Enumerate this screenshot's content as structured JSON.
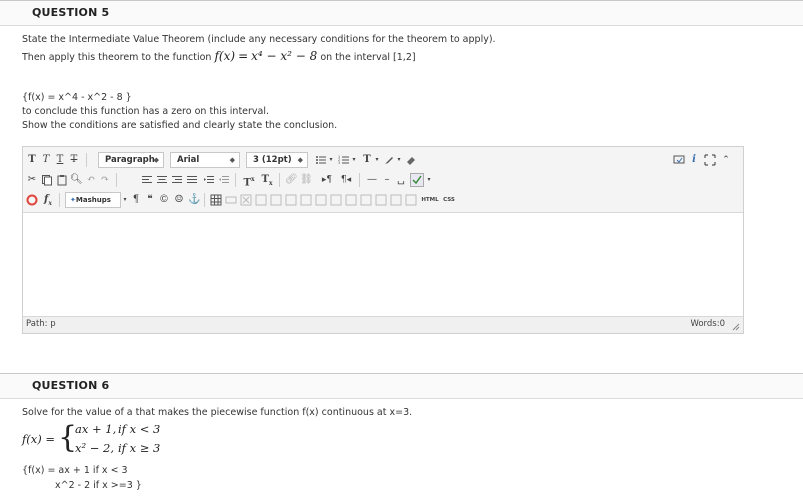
{
  "q5": {
    "title": "QUESTION 5",
    "line1": "State the Intermediate Value Theorem (include any necessary conditions for the theorem to apply).",
    "line2_pre": "Then apply this theorem to the function ",
    "fx": "f(x)",
    "eq": "=",
    "expr": "x⁴ − x² − 8",
    "line2_post": " on the interval [1,2]",
    "answer_code": "{f(x) = x^4 - x^2 - 8  }",
    "line3": "to conclude this function has a zero on this interval.",
    "line4": "Show the conditions are satisfied and clearly state the conclusion."
  },
  "editor": {
    "format_select": "Paragraph",
    "font_select": "Arial",
    "size_select": "3 (12pt)",
    "mashups_label": "Mashups",
    "html_label": "HTML",
    "css_label": "CSS",
    "path_label": "Path: p",
    "words_label": "Words:0"
  },
  "q6": {
    "title": "QUESTION 6",
    "line1": "Solve for the value of a that makes the piecewise function f(x) continuous at x=3.",
    "fx": "f(x) =",
    "case1_expr": "ax + 1,",
    "case1_cond": "if x < 3",
    "case2_expr": "x² − 2,",
    "case2_cond": "if x ≥ 3",
    "code_line1": "{f(x) =  ax + 1  if x < 3",
    "code_line2": "x^2 - 2 if x >=3  }"
  },
  "colors": {
    "accent_red": "#e0443a",
    "toolbar_bg": "#f4f4f4",
    "icon_gray": "#666666",
    "icon_blue": "#3a6fb0"
  }
}
